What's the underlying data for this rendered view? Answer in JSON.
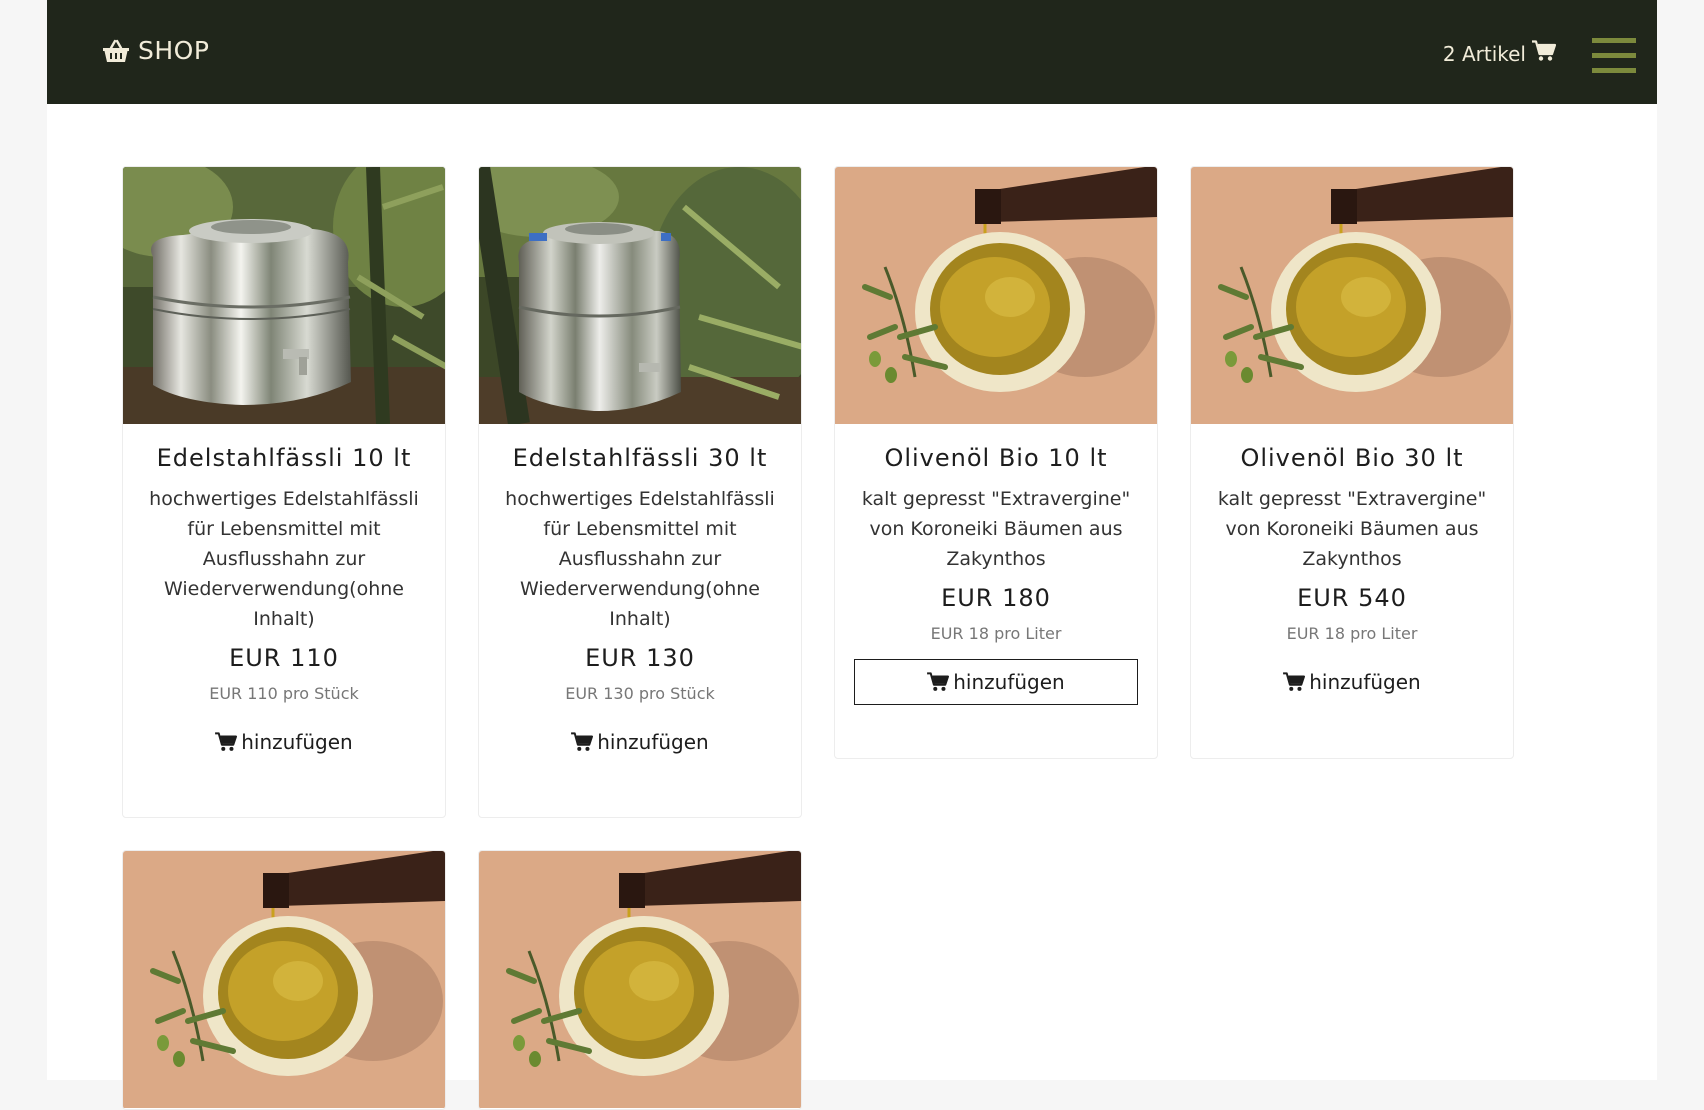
{
  "header": {
    "brand_label": "SHOP",
    "brand_icon": "basket-icon",
    "cart_label": "2 Artikel",
    "cart_icon": "cart-icon",
    "menu_icon": "hamburger-menu-icon",
    "bg_color": "#20261b",
    "accent_color": "#7c8a3c"
  },
  "products": [
    {
      "name": "Edelstahlfässli 10 lt",
      "description": "hochwertiges Edelstahlfässli für Lebensmittel mit Ausflusshahn zur Wiederverwendung(ohne Inhalt)",
      "price": "EUR 110",
      "unit_price": "EUR 110 pro Stück",
      "add_label": "hinzufügen",
      "image": "stainless-keg"
    },
    {
      "name": "Edelstahlfässli 30 lt",
      "description": "hochwertiges Edelstahlfässli für Lebensmittel mit Ausflusshahn zur Wiederverwendung(ohne Inhalt)",
      "price": "EUR 130",
      "unit_price": "EUR 130 pro Stück",
      "add_label": "hinzufügen",
      "image": "stainless-keg"
    },
    {
      "name": "Olivenöl Bio 10 lt",
      "description": "kalt gepresst \"Extravergine\" von Koroneiki Bäumen aus Zakynthos",
      "price": "EUR 180",
      "unit_price": "EUR 18 pro Liter",
      "add_label": "hinzufügen",
      "image": "olive-oil-bowl"
    },
    {
      "name": "Olivenöl Bio 30 lt",
      "description": "kalt gepresst \"Extravergine\" von Koroneiki Bäumen aus Zakynthos",
      "price": "EUR 540",
      "unit_price": "EUR 18 pro Liter",
      "add_label": "hinzufügen",
      "image": "olive-oil-bowl"
    },
    {
      "image": "olive-oil-bowl"
    },
    {
      "image": "olive-oil-bowl"
    }
  ]
}
